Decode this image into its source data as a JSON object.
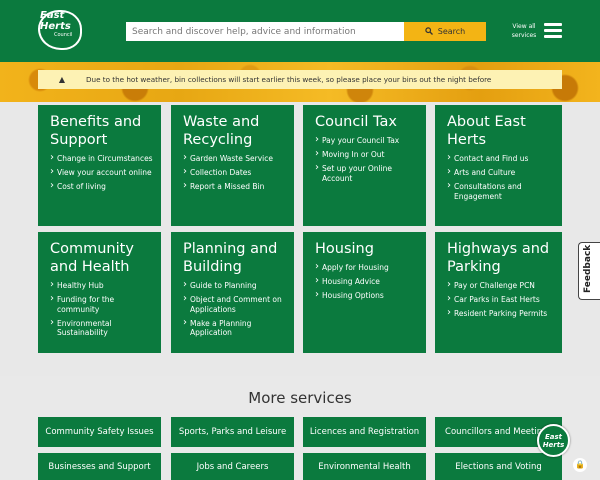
{
  "header": {
    "logo_line1": "East",
    "logo_line2": "Herts",
    "logo_line3": "Council",
    "search_placeholder": "Search and discover help, advice and information",
    "search_button": "Search",
    "view_all_line1": "View all",
    "view_all_line2": "services",
    "brand_color": "#0b7a3e",
    "accent_color": "#f3b414"
  },
  "alert": {
    "icon": "warning-icon",
    "message": "Due to the hot weather, bin collections will start earlier this week, so please place your bins out the night before"
  },
  "cards": [
    {
      "title": "Benefits and Support",
      "links": [
        "Change in Circumstances",
        "View your account online",
        "Cost of living"
      ]
    },
    {
      "title": "Waste and Recycling",
      "links": [
        "Garden Waste Service",
        "Collection Dates",
        "Report a Missed Bin"
      ]
    },
    {
      "title": "Council Tax",
      "links": [
        "Pay your Council Tax",
        "Moving In or Out",
        "Set up your Online Account"
      ]
    },
    {
      "title": "About East Herts",
      "links": [
        "Contact and Find us",
        "Arts and Culture",
        "Consultations and Engagement"
      ]
    },
    {
      "title": "Community and Health",
      "links": [
        "Healthy Hub",
        "Funding for the community",
        "Environmental Sustainability"
      ]
    },
    {
      "title": "Planning and Building",
      "links": [
        "Guide to Planning",
        "Object and Comment on Applications",
        "Make a Planning Application"
      ]
    },
    {
      "title": "Housing",
      "links": [
        "Apply for Housing",
        "Housing Advice",
        "Housing Options"
      ]
    },
    {
      "title": "Highways and Parking",
      "links": [
        "Pay or Challenge PCN",
        "Car Parks in East Herts",
        "Resident Parking Permits"
      ]
    }
  ],
  "feedback_tab": "Feedback",
  "more_services": {
    "title": "More services",
    "items": [
      "Community Safety Issues",
      "Sports, Parks and Leisure",
      "Licences and Registration",
      "Councillors and Meetings",
      "Businesses and Support",
      "Jobs and Careers",
      "Environmental Health",
      "Elections and Voting"
    ]
  },
  "chat_logo": {
    "line1": "East",
    "line2": "Herts"
  }
}
